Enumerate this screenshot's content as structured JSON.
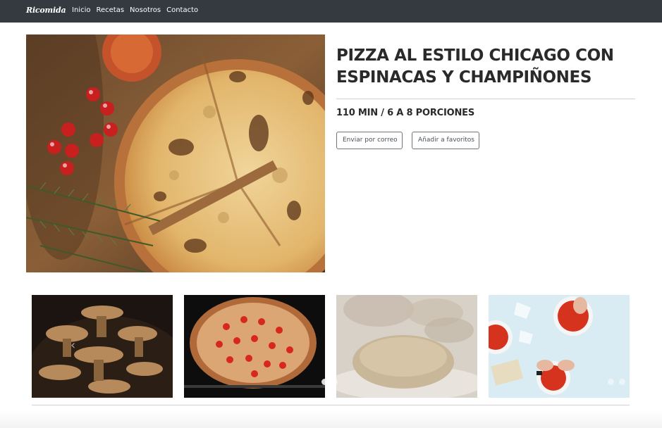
{
  "navbar": {
    "brand": "Ricomida",
    "links": [
      "Inicio",
      "Recetas",
      "Nosotros",
      "Contacto"
    ]
  },
  "recipe": {
    "title": "PIZZA AL ESTILO CHICAGO CON ESPINACAS Y CHAMPIÑONES",
    "meta": "110 MIN / 6 A 8 PORCIONES",
    "buttons": {
      "email": "Enviar por correo",
      "favorite": "Añadir a favoritos"
    }
  },
  "colors": {
    "navbar": "#343a40",
    "text": "#212529"
  }
}
